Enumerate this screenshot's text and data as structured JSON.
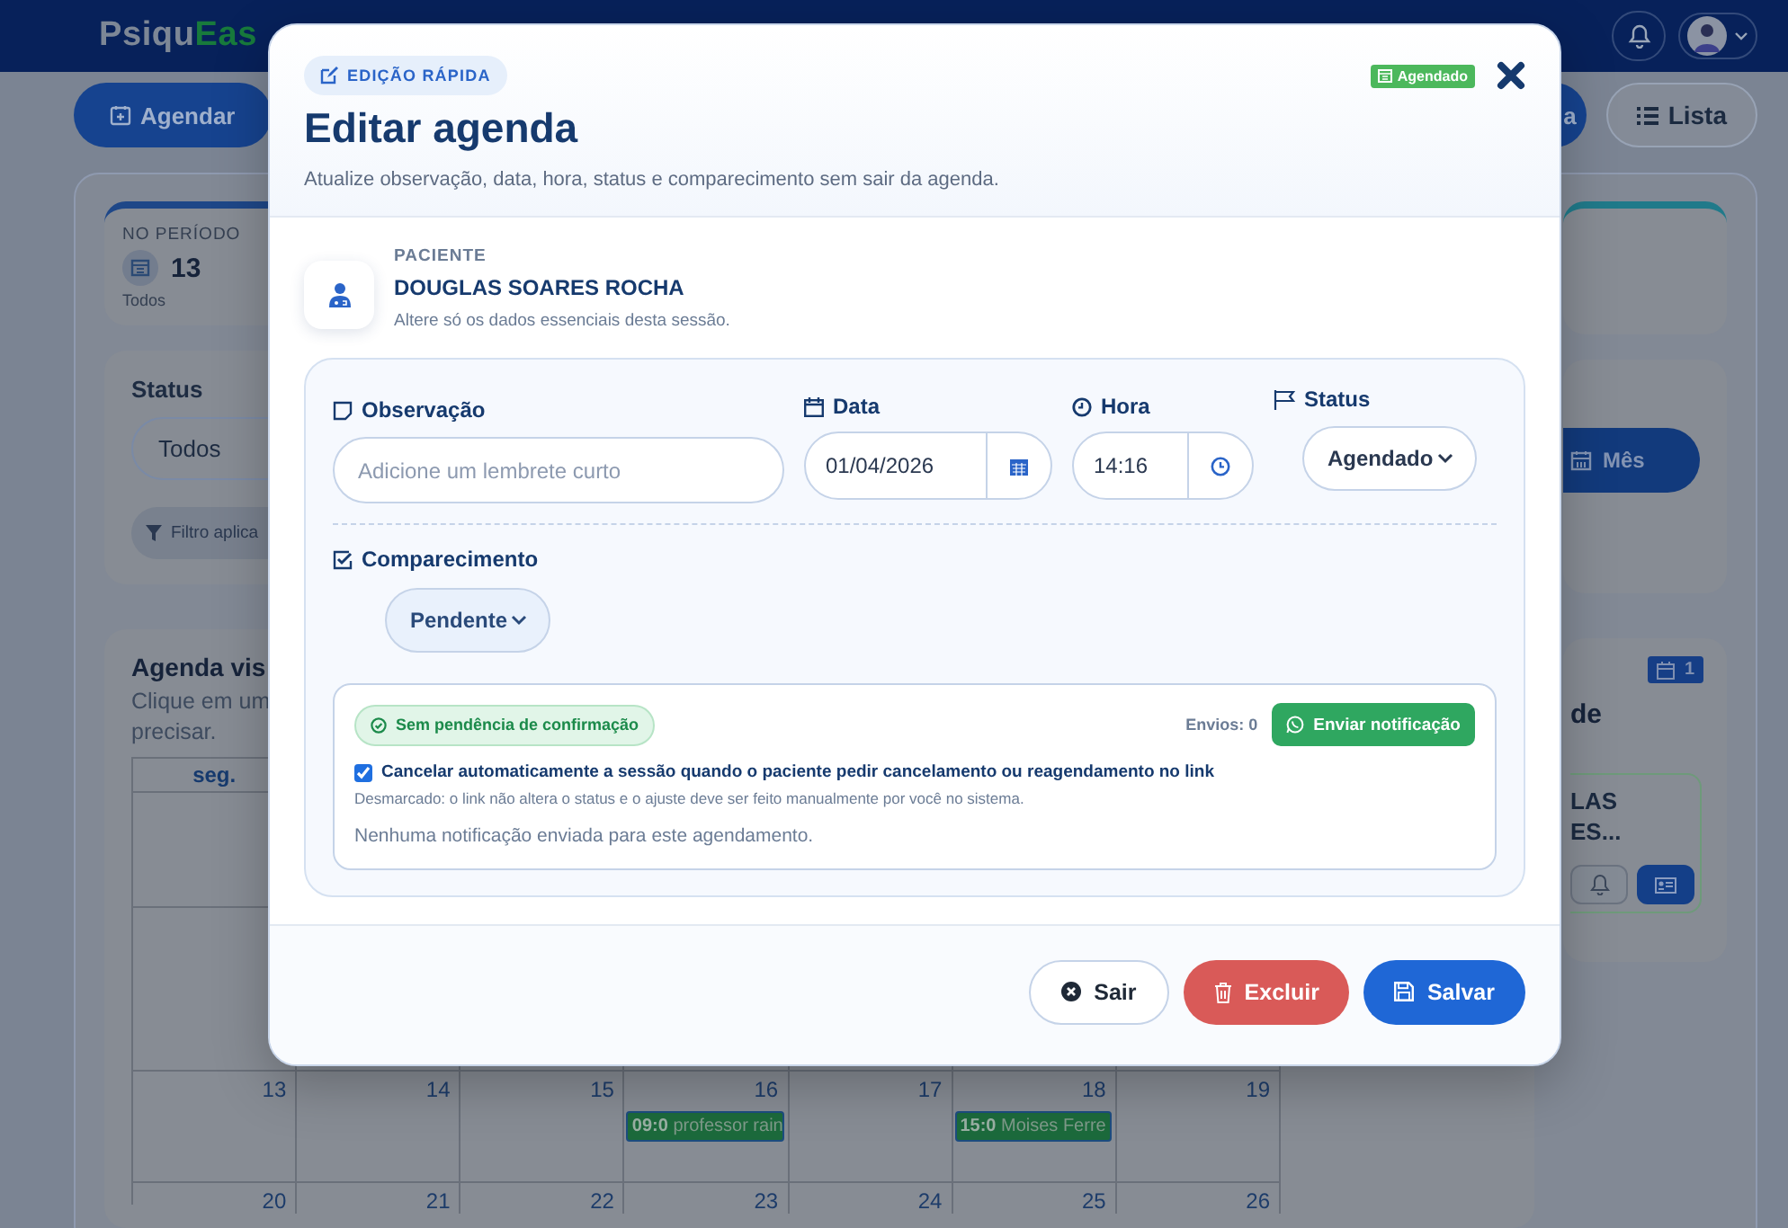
{
  "header": {
    "logo_primary": "Psiqu",
    "logo_accent": "Eas"
  },
  "toolbar": {
    "schedule_button": "Agendar",
    "partial_button": "a",
    "list_button": "Lista"
  },
  "stats": {
    "label": "NO PERÍODO",
    "value": "13",
    "caption": "Todos"
  },
  "filters": {
    "label": "Status",
    "select_value": "Todos",
    "filter_chip": "Filtro aplica",
    "month_button": "Mês"
  },
  "agenda": {
    "title": "Agenda vis",
    "hint_lines": [
      "Clique em um",
      "precisar."
    ],
    "weekday": "seg.",
    "weeks": [
      {
        "days": [
          {
            "day": "13"
          },
          {
            "day": "14"
          },
          {
            "day": "15"
          },
          {
            "day": "16",
            "event": {
              "time": "09:0",
              "text": "professor rain"
            }
          },
          {
            "day": "17"
          },
          {
            "day": "18",
            "event": {
              "time": "15:0",
              "text": "Moises Ferre"
            }
          },
          {
            "day": "19"
          }
        ]
      },
      {
        "days": [
          {
            "day": "20"
          },
          {
            "day": "21"
          },
          {
            "day": "22"
          },
          {
            "day": "23"
          },
          {
            "day": "24"
          },
          {
            "day": "25"
          },
          {
            "day": "26"
          }
        ]
      }
    ]
  },
  "side_card": {
    "count_badge": "1",
    "title_fragment": "de",
    "name_lines": [
      "LAS",
      "ES..."
    ]
  },
  "modal": {
    "badge": "EDIÇÃO RÁPIDA",
    "title": "Editar agenda",
    "subtitle": "Atualize observação, data, hora, status e comparecimento sem sair da agenda.",
    "status_tag": "Agendado",
    "patient": {
      "label": "PACIENTE",
      "name": "DOUGLAS SOARES ROCHA",
      "hint": "Altere só os dados essenciais desta sessão."
    },
    "observation": {
      "label": "Observação",
      "placeholder": "Adicione um lembrete curto"
    },
    "date": {
      "label": "Data",
      "value": "01/04/2026"
    },
    "time": {
      "label": "Hora",
      "value": "14:16"
    },
    "status": {
      "label": "Status",
      "value": "Agendado"
    },
    "attendance": {
      "label": "Comparecimento",
      "value": "Pendente"
    },
    "notification": {
      "status_text": "Sem pendência de confirmação",
      "sends": "Envios: 0",
      "button": "Enviar notificação",
      "auto_cancel": {
        "checked": true,
        "label": "Cancelar automaticamente a sessão quando o paciente pedir cancelamento ou reagendamento no link"
      },
      "note": "Desmarcado: o link não altera o status e o ajuste deve ser feito manualmente por você no sistema.",
      "empty_message": "Nenhuma notificação enviada para este agendamento."
    },
    "buttons": [
      {
        "kind": "secondary",
        "label": "Sair"
      },
      {
        "kind": "danger",
        "label": "Excluir"
      },
      {
        "kind": "primary",
        "label": "Salvar"
      }
    ]
  }
}
